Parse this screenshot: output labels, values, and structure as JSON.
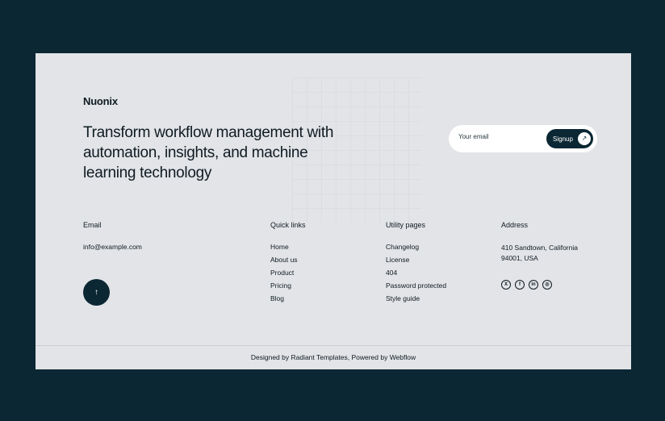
{
  "brand": {
    "logo": "Nuonix"
  },
  "hero": {
    "headline": "Transform workflow management with automation, insights, and machine learning technology"
  },
  "newsletter": {
    "placeholder": "Your email",
    "button_label": "Signup",
    "button_icon": "arrow-up-right-icon"
  },
  "columns": {
    "email": {
      "title": "Email",
      "value": "info@example.com"
    },
    "quick_links": {
      "title": "Quick links",
      "items": [
        "Home",
        "About us",
        "Product",
        "Pricing",
        "Blog"
      ]
    },
    "utility_pages": {
      "title": "Utility pages",
      "items": [
        "Changelog",
        "License",
        "404",
        "Password protected",
        "Style guide"
      ]
    },
    "address": {
      "title": "Address",
      "value": "410 Sandtown, California 94001, USA"
    }
  },
  "socials": [
    "x-icon",
    "facebook-icon",
    "linkedin-icon",
    "instagram-icon"
  ],
  "back_to_top": {
    "icon": "arrow-up-icon"
  },
  "footer": {
    "credits": "Designed by Radiant Templates, Powered by Webflow"
  },
  "colors": {
    "background": "#0b2733",
    "panel": "#e2e4e7",
    "accent": "#0b2733"
  }
}
